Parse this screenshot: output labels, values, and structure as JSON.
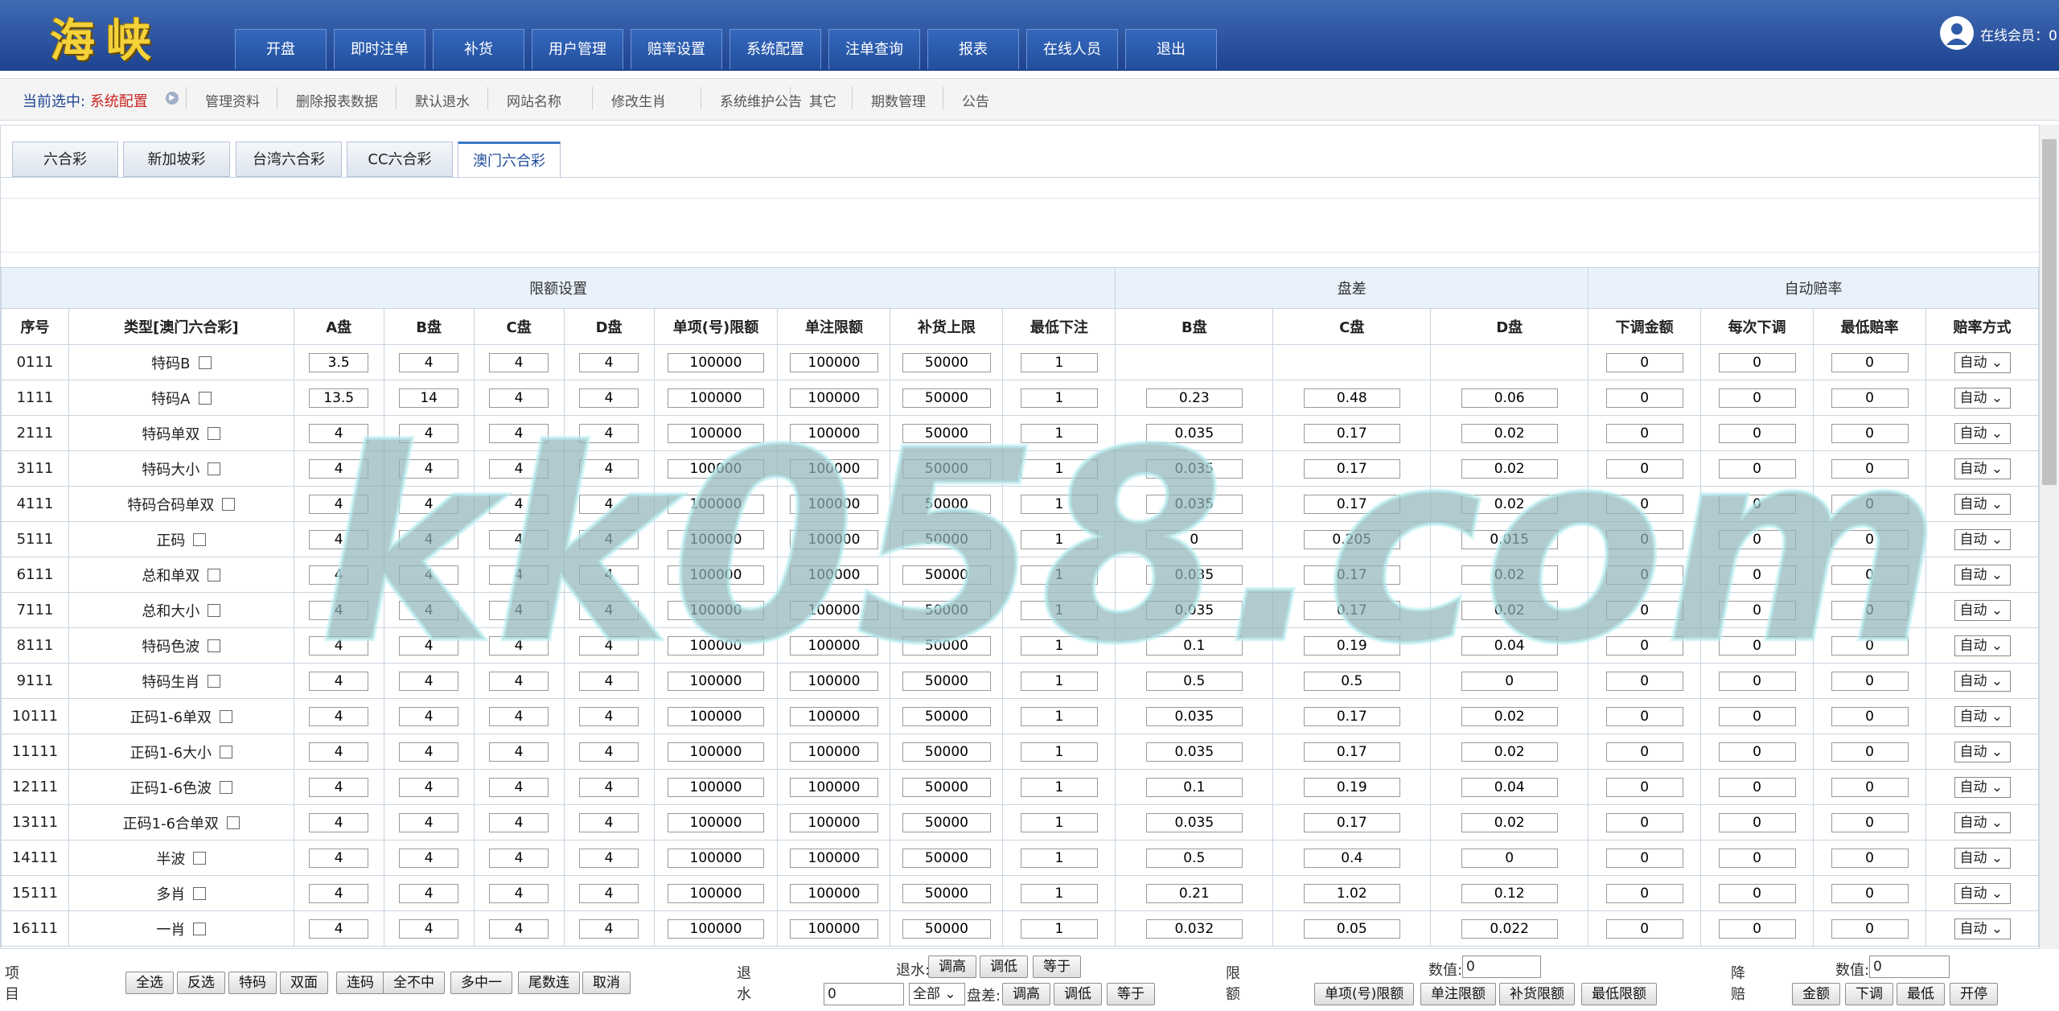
{
  "header": {
    "logo_text": "海峡",
    "nav": [
      "开盘",
      "即时注单",
      "补货",
      "用户管理",
      "赔率设置",
      "系统配置",
      "注单查询",
      "报表",
      "在线人员",
      "退出"
    ],
    "online_label": "在线会员：0"
  },
  "subnav": {
    "current_label": "当前选中:",
    "current_value": "系统配置",
    "items": [
      "管理资料",
      "删除报表数据",
      "默认退水",
      "网站名称",
      "修改生肖",
      "系统维护公告",
      "其它",
      "期数管理",
      "公告"
    ]
  },
  "tabs": [
    "六合彩",
    "新加坡彩",
    "台湾六合彩",
    "CC六合彩",
    "澳门六合彩"
  ],
  "active_tab": "澳门六合彩",
  "table": {
    "group_headers": [
      "限额设置",
      "盘差",
      "自动赔率"
    ],
    "headers": [
      "序号",
      "类型[澳门六合彩]",
      "A盘",
      "B盘",
      "C盘",
      "D盘",
      "单项(号)限额",
      "单注限额",
      "补货上限",
      "最低下注",
      "B盘",
      "C盘",
      "D盘",
      "下调金额",
      "每次下调",
      "最低赔率",
      "赔率方式"
    ],
    "rows": [
      {
        "id": "0111",
        "name": "特码B",
        "a": "3.5",
        "b": "4",
        "c": "4",
        "d": "4",
        "single_item": "100000",
        "single_bet": "100000",
        "restock": "50000",
        "min_bet": "1",
        "pb": "",
        "pc": "",
        "pd": "",
        "down_amount": "0",
        "each_down": "0",
        "min_odds": "0",
        "mode": "自动"
      },
      {
        "id": "1111",
        "name": "特码A",
        "a": "13.5",
        "b": "14",
        "c": "4",
        "d": "4",
        "single_item": "100000",
        "single_bet": "100000",
        "restock": "50000",
        "min_bet": "1",
        "pb": "0.23",
        "pc": "0.48",
        "pd": "0.06",
        "down_amount": "0",
        "each_down": "0",
        "min_odds": "0",
        "mode": "自动"
      },
      {
        "id": "2111",
        "name": "特码单双",
        "a": "4",
        "b": "4",
        "c": "4",
        "d": "4",
        "single_item": "100000",
        "single_bet": "100000",
        "restock": "50000",
        "min_bet": "1",
        "pb": "0.035",
        "pc": "0.17",
        "pd": "0.02",
        "down_amount": "0",
        "each_down": "0",
        "min_odds": "0",
        "mode": "自动"
      },
      {
        "id": "3111",
        "name": "特码大小",
        "a": "4",
        "b": "4",
        "c": "4",
        "d": "4",
        "single_item": "100000",
        "single_bet": "100000",
        "restock": "50000",
        "min_bet": "1",
        "pb": "0.035",
        "pc": "0.17",
        "pd": "0.02",
        "down_amount": "0",
        "each_down": "0",
        "min_odds": "0",
        "mode": "自动"
      },
      {
        "id": "4111",
        "name": "特码合码单双",
        "a": "4",
        "b": "4",
        "c": "4",
        "d": "4",
        "single_item": "100000",
        "single_bet": "100000",
        "restock": "50000",
        "min_bet": "1",
        "pb": "0.035",
        "pc": "0.17",
        "pd": "0.02",
        "down_amount": "0",
        "each_down": "0",
        "min_odds": "0",
        "mode": "自动"
      },
      {
        "id": "5111",
        "name": "正码",
        "a": "4",
        "b": "4",
        "c": "4",
        "d": "4",
        "single_item": "100000",
        "single_bet": "100000",
        "restock": "50000",
        "min_bet": "1",
        "pb": "0",
        "pc": "0.205",
        "pd": "0.015",
        "down_amount": "0",
        "each_down": "0",
        "min_odds": "0",
        "mode": "自动"
      },
      {
        "id": "6111",
        "name": "总和单双",
        "a": "4",
        "b": "4",
        "c": "4",
        "d": "4",
        "single_item": "100000",
        "single_bet": "100000",
        "restock": "50000",
        "min_bet": "1",
        "pb": "0.035",
        "pc": "0.17",
        "pd": "0.02",
        "down_amount": "0",
        "each_down": "0",
        "min_odds": "0",
        "mode": "自动"
      },
      {
        "id": "7111",
        "name": "总和大小",
        "a": "4",
        "b": "4",
        "c": "4",
        "d": "4",
        "single_item": "100000",
        "single_bet": "100000",
        "restock": "50000",
        "min_bet": "1",
        "pb": "0.035",
        "pc": "0.17",
        "pd": "0.02",
        "down_amount": "0",
        "each_down": "0",
        "min_odds": "0",
        "mode": "自动"
      },
      {
        "id": "8111",
        "name": "特码色波",
        "a": "4",
        "b": "4",
        "c": "4",
        "d": "4",
        "single_item": "100000",
        "single_bet": "100000",
        "restock": "50000",
        "min_bet": "1",
        "pb": "0.1",
        "pc": "0.19",
        "pd": "0.04",
        "down_amount": "0",
        "each_down": "0",
        "min_odds": "0",
        "mode": "自动"
      },
      {
        "id": "9111",
        "name": "特码生肖",
        "a": "4",
        "b": "4",
        "c": "4",
        "d": "4",
        "single_item": "100000",
        "single_bet": "100000",
        "restock": "50000",
        "min_bet": "1",
        "pb": "0.5",
        "pc": "0.5",
        "pd": "0",
        "down_amount": "0",
        "each_down": "0",
        "min_odds": "0",
        "mode": "自动"
      },
      {
        "id": "10111",
        "name": "正码1-6单双",
        "a": "4",
        "b": "4",
        "c": "4",
        "d": "4",
        "single_item": "100000",
        "single_bet": "100000",
        "restock": "50000",
        "min_bet": "1",
        "pb": "0.035",
        "pc": "0.17",
        "pd": "0.02",
        "down_amount": "0",
        "each_down": "0",
        "min_odds": "0",
        "mode": "自动"
      },
      {
        "id": "11111",
        "name": "正码1-6大小",
        "a": "4",
        "b": "4",
        "c": "4",
        "d": "4",
        "single_item": "100000",
        "single_bet": "100000",
        "restock": "50000",
        "min_bet": "1",
        "pb": "0.035",
        "pc": "0.17",
        "pd": "0.02",
        "down_amount": "0",
        "each_down": "0",
        "min_odds": "0",
        "mode": "自动"
      },
      {
        "id": "12111",
        "name": "正码1-6色波",
        "a": "4",
        "b": "4",
        "c": "4",
        "d": "4",
        "single_item": "100000",
        "single_bet": "100000",
        "restock": "50000",
        "min_bet": "1",
        "pb": "0.1",
        "pc": "0.19",
        "pd": "0.04",
        "down_amount": "0",
        "each_down": "0",
        "min_odds": "0",
        "mode": "自动"
      },
      {
        "id": "13111",
        "name": "正码1-6合单双",
        "a": "4",
        "b": "4",
        "c": "4",
        "d": "4",
        "single_item": "100000",
        "single_bet": "100000",
        "restock": "50000",
        "min_bet": "1",
        "pb": "0.035",
        "pc": "0.17",
        "pd": "0.02",
        "down_amount": "0",
        "each_down": "0",
        "min_odds": "0",
        "mode": "自动"
      },
      {
        "id": "14111",
        "name": "半波",
        "a": "4",
        "b": "4",
        "c": "4",
        "d": "4",
        "single_item": "100000",
        "single_bet": "100000",
        "restock": "50000",
        "min_bet": "1",
        "pb": "0.5",
        "pc": "0.4",
        "pd": "0",
        "down_amount": "0",
        "each_down": "0",
        "min_odds": "0",
        "mode": "自动"
      },
      {
        "id": "15111",
        "name": "多肖",
        "a": "4",
        "b": "4",
        "c": "4",
        "d": "4",
        "single_item": "100000",
        "single_bet": "100000",
        "restock": "50000",
        "min_bet": "1",
        "pb": "0.21",
        "pc": "1.02",
        "pd": "0.12",
        "down_amount": "0",
        "each_down": "0",
        "min_odds": "0",
        "mode": "自动"
      },
      {
        "id": "16111",
        "name": "一肖",
        "a": "4",
        "b": "4",
        "c": "4",
        "d": "4",
        "single_item": "100000",
        "single_bet": "100000",
        "restock": "50000",
        "min_bet": "1",
        "pb": "0.032",
        "pc": "0.05",
        "pd": "0.022",
        "down_amount": "0",
        "each_down": "0",
        "min_odds": "0",
        "mode": "自动"
      }
    ]
  },
  "watermark": "kk058.com",
  "bottom": {
    "item_label_top": "项",
    "item_label_bottom": "目",
    "item_buttons": [
      "全选",
      "反选",
      "特码",
      "双面",
      "连码",
      "全不中",
      "多中一",
      "尾数连",
      "取消"
    ],
    "rebate_label_top": "退",
    "rebate_label_bottom": "水",
    "rebate_text": "退水:",
    "rebate_buttons": [
      "调高",
      "调低",
      "等于"
    ],
    "rebate_input": "0",
    "rebate_select": "全部",
    "diff_label": "盘差:",
    "diff_buttons": [
      "调高",
      "调低",
      "等于"
    ],
    "limit_label_top": "限",
    "limit_label_bottom": "额",
    "limit_value_label": "数值:",
    "limit_value": "0",
    "limit_buttons": [
      "单项(号)限额",
      "单注限额",
      "补货限额",
      "最低限额"
    ],
    "reduce_label_top": "降",
    "reduce_label_bottom": "赔",
    "reduce_value_label": "数值:",
    "reduce_value": "0",
    "reduce_buttons": [
      "金额",
      "下调",
      "最低",
      "开停"
    ]
  }
}
